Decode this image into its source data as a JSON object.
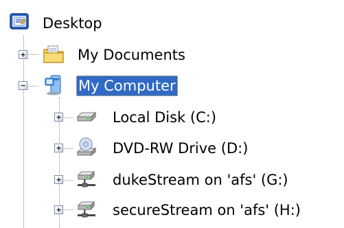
{
  "tree": {
    "root": {
      "label": "Desktop",
      "icon": "desktop-icon",
      "expanded": true
    },
    "items": [
      {
        "label": "My Documents",
        "icon": "my-documents-folder-icon",
        "expander": "+"
      },
      {
        "label": "My Computer",
        "icon": "my-computer-icon",
        "expander": "−",
        "selected": true,
        "children": [
          {
            "label": "Local Disk (C:)",
            "icon": "hard-disk-icon",
            "expander": "+"
          },
          {
            "label": "DVD-RW Drive (D:)",
            "icon": "dvd-drive-icon",
            "expander": "+"
          },
          {
            "label": "dukeStream on 'afs' (G:)",
            "icon": "network-drive-icon",
            "expander": "+"
          },
          {
            "label": "secureStream on 'afs' (H:)",
            "icon": "network-drive-icon",
            "expander": "+"
          }
        ]
      }
    ]
  },
  "colors": {
    "selection_background": "#316ac5",
    "selection_text": "#ffffff",
    "tree_line": "#8a8a8a"
  }
}
